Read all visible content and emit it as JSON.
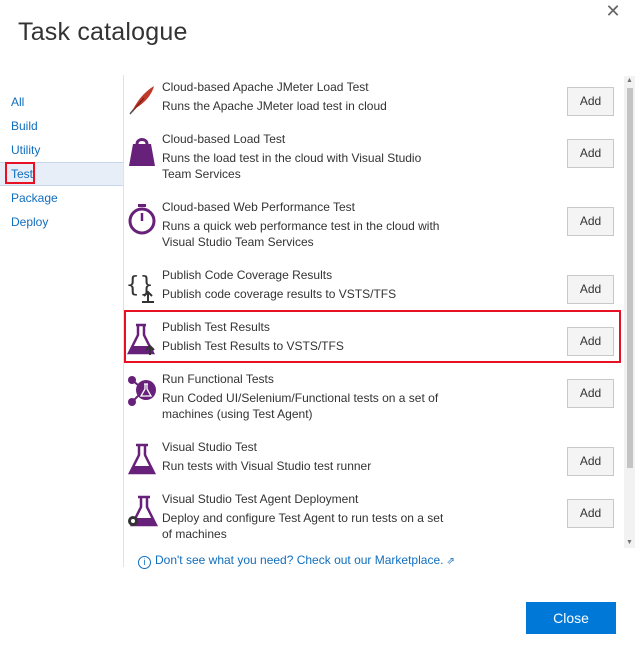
{
  "dialog": {
    "title": "Task catalogue",
    "close_glyph": "✕",
    "close_button": "Close"
  },
  "sidebar": {
    "items": [
      {
        "label": "All"
      },
      {
        "label": "Build"
      },
      {
        "label": "Utility"
      },
      {
        "label": "Test",
        "selected": true
      },
      {
        "label": "Package"
      },
      {
        "label": "Deploy"
      }
    ]
  },
  "tasks": [
    {
      "icon": "jmeter-feather-icon",
      "name": "Cloud-based Apache JMeter Load Test",
      "description": "Runs the Apache JMeter load test in cloud",
      "add_label": "Add"
    },
    {
      "icon": "load-test-weight-icon",
      "name": "Cloud-based Load Test",
      "description": "Runs the load test in the cloud with Visual Studio Team Services",
      "add_label": "Add"
    },
    {
      "icon": "stopwatch-icon",
      "name": "Cloud-based Web Performance Test",
      "description": "Runs a quick web performance test in the cloud with Visual Studio Team Services",
      "add_label": "Add"
    },
    {
      "icon": "code-coverage-publish-icon",
      "name": "Publish Code Coverage Results",
      "description": "Publish code coverage results to VSTS/TFS",
      "add_label": "Add"
    },
    {
      "icon": "flask-publish-icon",
      "name": "Publish Test Results",
      "description": "Publish Test Results to VSTS/TFS",
      "add_label": "Add",
      "highlighted": true
    },
    {
      "icon": "functional-test-nodes-icon",
      "name": "Run Functional Tests",
      "description": "Run Coded UI/Selenium/Functional tests on a set of machines (using Test Agent)",
      "add_label": "Add"
    },
    {
      "icon": "flask-icon",
      "name": "Visual Studio Test",
      "description": "Run tests with Visual Studio test runner",
      "add_label": "Add"
    },
    {
      "icon": "flask-gear-icon",
      "name": "Visual Studio Test Agent Deployment",
      "description": "Deploy and configure Test Agent to run tests on a set of machines",
      "add_label": "Add"
    }
  ],
  "marketplace": {
    "info_glyph": "i",
    "text": "Don't see what you need? Check out our Marketplace.",
    "external_glyph": "⇗"
  },
  "colors": {
    "accent": "#0078d7",
    "link": "#106ebe",
    "icon_purple": "#68217a",
    "highlight": "#e81123"
  }
}
